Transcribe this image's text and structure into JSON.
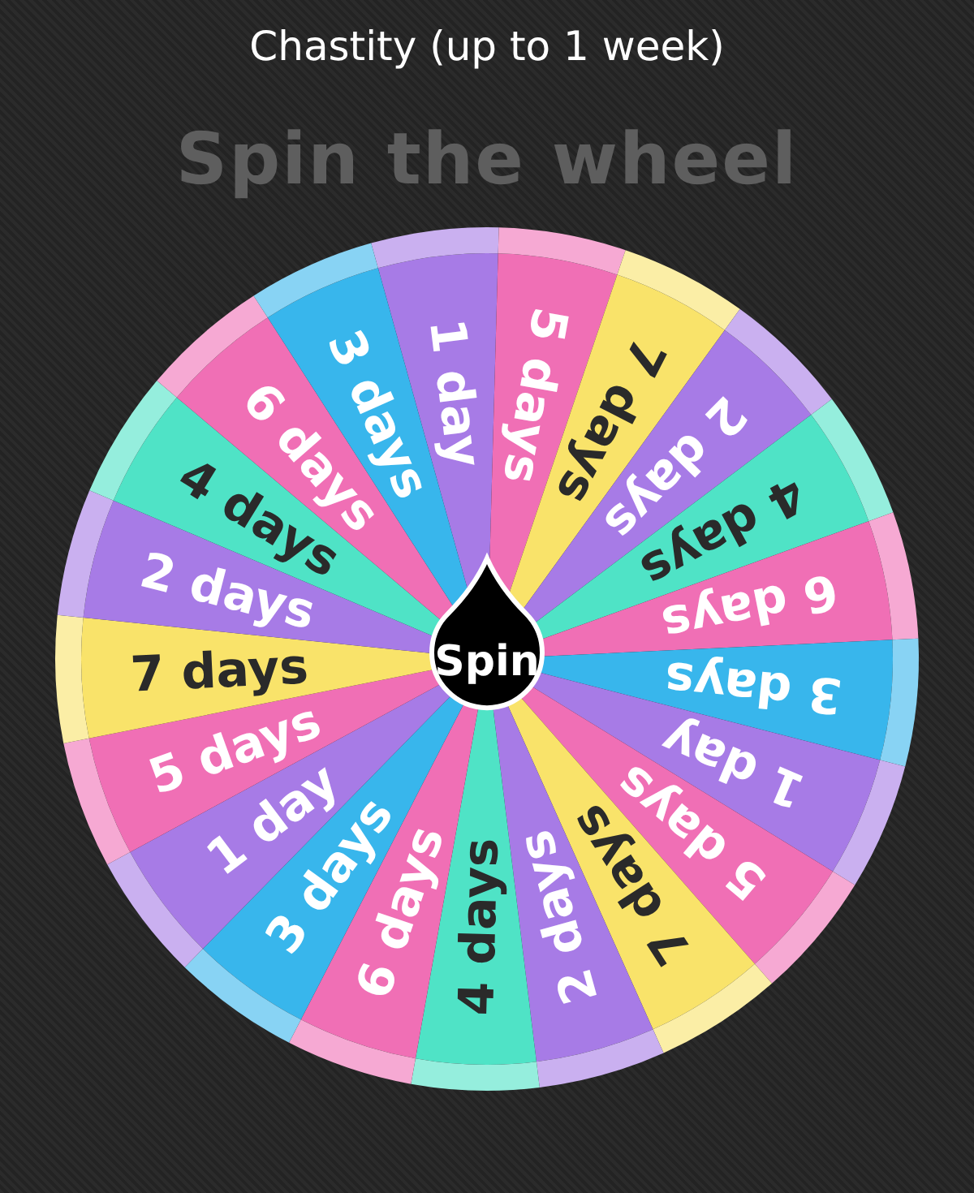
{
  "title": "Chastity (up to 1 week)",
  "heading": "Spin the wheel",
  "wheel": {
    "segments": [
      {
        "label": "1 day",
        "color": "#a77be6"
      },
      {
        "label": "5 days",
        "color": "#f06fb5"
      },
      {
        "label": "7 days",
        "color": "#f9e36a"
      },
      {
        "label": "2 days",
        "color": "#a77be6"
      },
      {
        "label": "4 days",
        "color": "#4fe3c6"
      },
      {
        "label": "6 days",
        "color": "#f06fb5"
      },
      {
        "label": "3 days",
        "color": "#38b6ec"
      },
      {
        "label": "1 day",
        "color": "#a77be6"
      },
      {
        "label": "5 days",
        "color": "#f06fb5"
      },
      {
        "label": "7 days",
        "color": "#f9e36a"
      },
      {
        "label": "2 days",
        "color": "#a77be6"
      },
      {
        "label": "4 days",
        "color": "#4fe3c6"
      },
      {
        "label": "6 days",
        "color": "#f06fb5"
      },
      {
        "label": "3 days",
        "color": "#38b6ec"
      },
      {
        "label": "1 day",
        "color": "#a77be6"
      },
      {
        "label": "5 days",
        "color": "#f06fb5"
      },
      {
        "label": "7 days",
        "color": "#f9e36a"
      },
      {
        "label": "2 days",
        "color": "#a77be6"
      },
      {
        "label": "4 days",
        "color": "#4fe3c6"
      },
      {
        "label": "6 days",
        "color": "#f06fb5"
      },
      {
        "label": "3 days",
        "color": "#38b6ec"
      }
    ]
  },
  "spin_button": {
    "label": "Spin"
  }
}
